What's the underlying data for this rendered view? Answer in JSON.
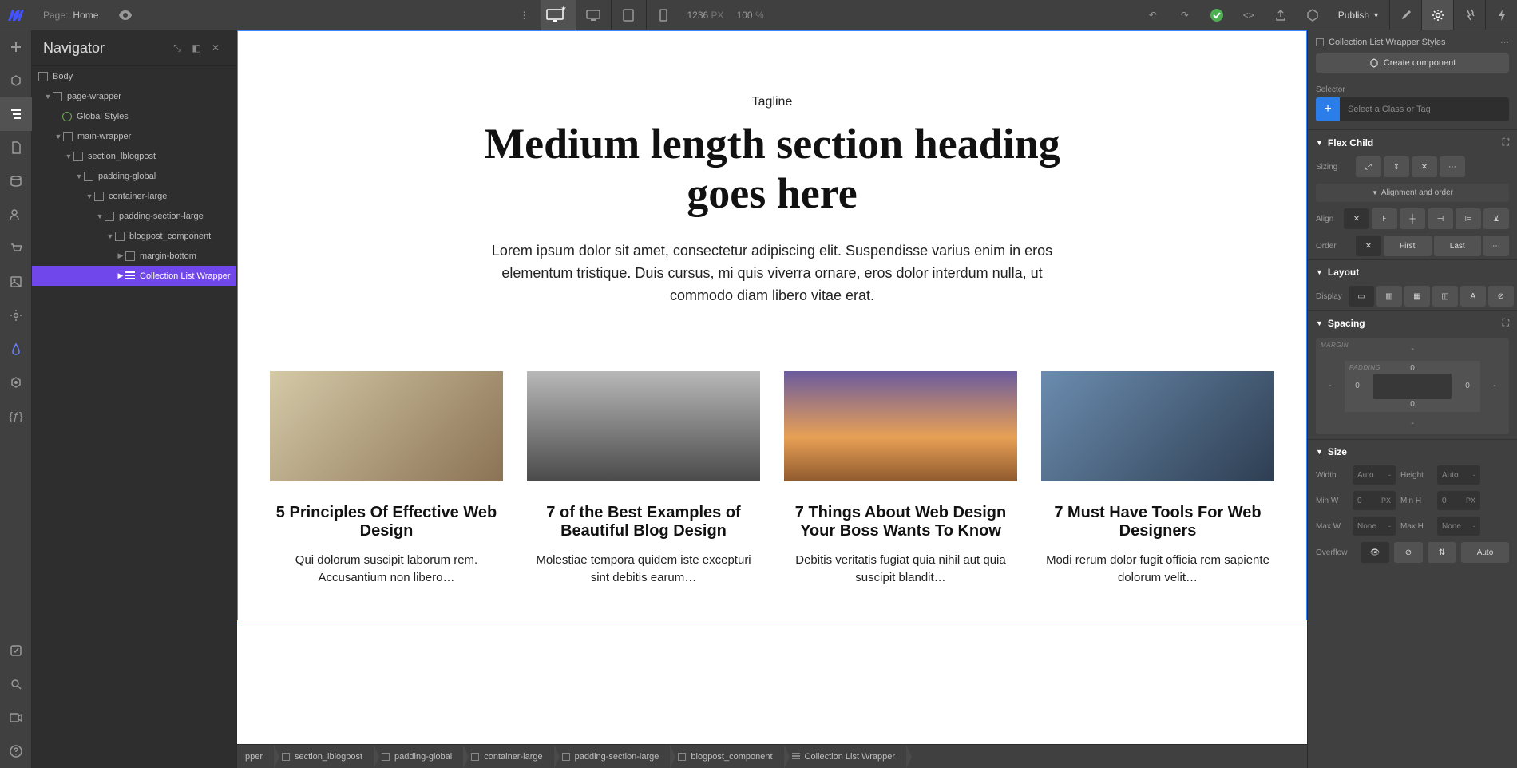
{
  "topbar": {
    "page_label": "Page:",
    "page_name": "Home",
    "width": "1236",
    "width_unit": "PX",
    "zoom": "100",
    "zoom_unit": "%",
    "publish": "Publish"
  },
  "navigator": {
    "title": "Navigator",
    "tree": {
      "body": "Body",
      "page_wrapper": "page-wrapper",
      "global_styles": "Global Styles",
      "main_wrapper": "main-wrapper",
      "section_blogpost": "section_lblogpost",
      "padding_global": "padding-global",
      "container_large": "container-large",
      "padding_section_large": "padding-section-large",
      "blogpost_component": "blogpost_component",
      "margin_bottom": "margin-bottom",
      "collection_list_wrapper": "Collection List Wrapper"
    }
  },
  "canvas": {
    "tagline": "Tagline",
    "heading": "Medium length section heading goes here",
    "subtext": "Lorem ipsum dolor sit amet, consectetur adipiscing elit. Suspendisse varius enim in eros elementum tristique. Duis cursus, mi quis viverra ornare, eros dolor interdum nulla, ut commodo diam libero vitae erat.",
    "cards": [
      {
        "title": "5 Principles Of Effective Web Design",
        "text": "Qui dolorum suscipit laborum rem. Accusantium non libero…"
      },
      {
        "title": "7 of the Best Examples of Beautiful Blog Design",
        "text": "Molestiae tempora quidem iste excepturi sint debitis earum…"
      },
      {
        "title": "7 Things About Web Design Your Boss Wants To Know",
        "text": "Debitis veritatis fugiat quia nihil aut quia suscipit blandit…"
      },
      {
        "title": "7 Must Have Tools For Web Designers",
        "text": "Modi rerum dolor fugit officia rem sapiente dolorum velit…"
      }
    ]
  },
  "breadcrumb": {
    "items": [
      "pper",
      "section_lblogpost",
      "padding-global",
      "container-large",
      "padding-section-large",
      "blogpost_component",
      "Collection List Wrapper"
    ]
  },
  "rightpanel": {
    "header_title": "Collection List Wrapper Styles",
    "create_component": "Create component",
    "selector_label": "Selector",
    "selector_placeholder": "Select a Class or Tag",
    "flex_child": {
      "title": "Flex Child",
      "sizing": "Sizing",
      "alignment_order": "Alignment and order",
      "align": "Align",
      "order": "Order",
      "first": "First",
      "last": "Last"
    },
    "layout": {
      "title": "Layout",
      "display": "Display"
    },
    "spacing": {
      "title": "Spacing",
      "margin_label": "MARGIN",
      "padding_label": "PADDING",
      "m_top": "-",
      "m_right": "-",
      "m_bottom": "-",
      "m_left": "-",
      "p_top": "0",
      "p_right": "0",
      "p_bottom": "0",
      "p_left": "0"
    },
    "size": {
      "title": "Size",
      "width": "Width",
      "width_val": "Auto",
      "height": "Height",
      "height_val": "Auto",
      "min_w": "Min W",
      "min_w_val": "0",
      "min_w_unit": "PX",
      "min_h": "Min H",
      "min_h_val": "0",
      "min_h_unit": "PX",
      "max_w": "Max W",
      "max_w_val": "None",
      "max_h": "Max H",
      "max_h_val": "None",
      "overflow": "Overflow",
      "auto": "Auto"
    }
  }
}
